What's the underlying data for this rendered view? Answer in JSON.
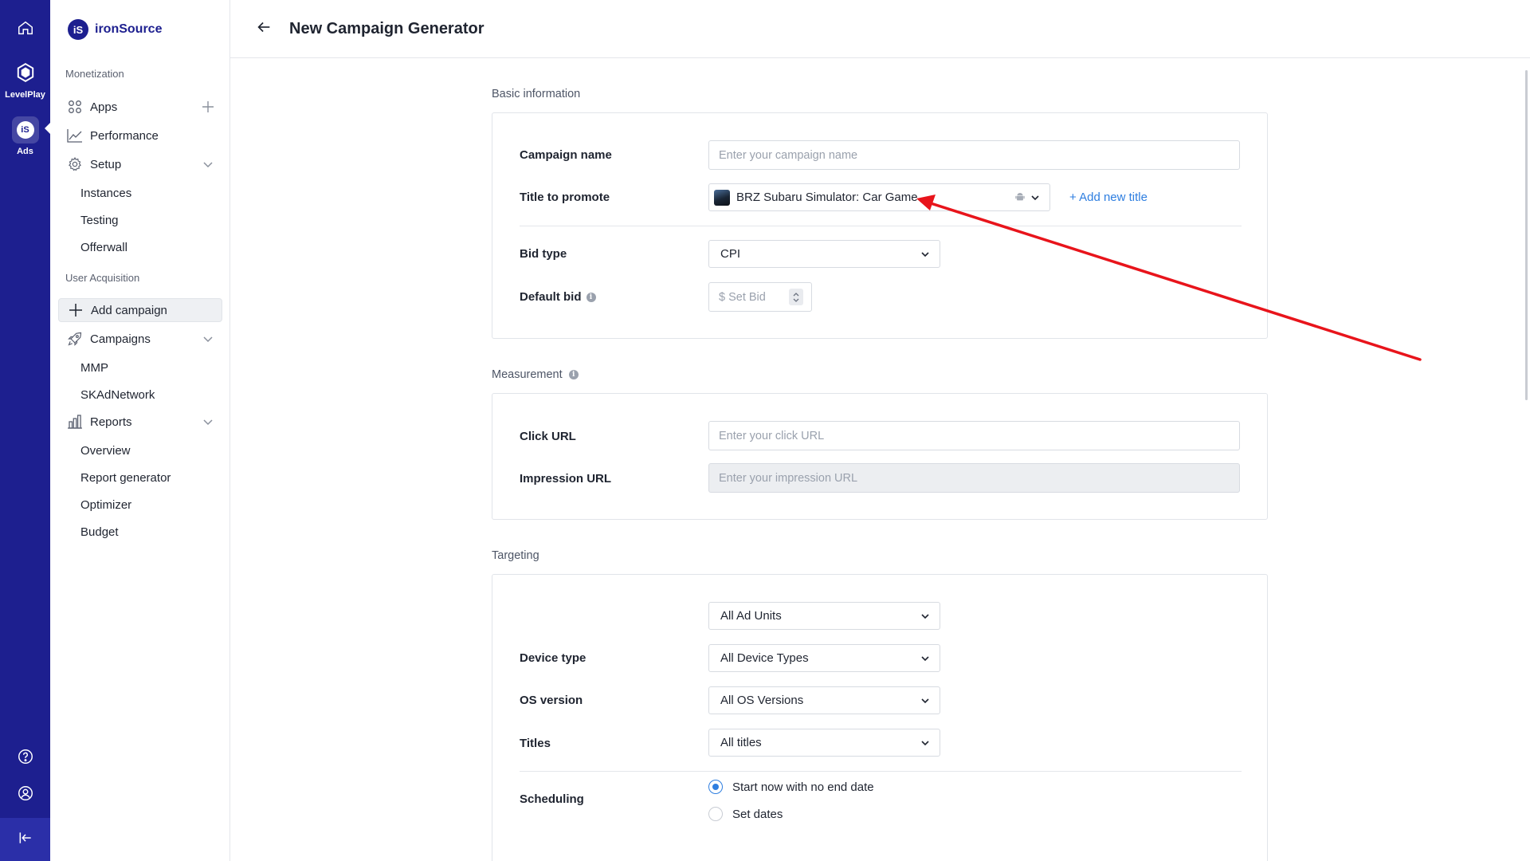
{
  "rail": {
    "levelplay_label": "LevelPlay",
    "ads_label": "Ads"
  },
  "brand": {
    "logo_text": "iS",
    "name": "ironSource"
  },
  "sidebar": {
    "monetization_title": "Monetization",
    "apps": "Apps",
    "performance": "Performance",
    "setup": "Setup",
    "instances": "Instances",
    "testing": "Testing",
    "offerwall": "Offerwall",
    "ua_title": "User Acquisition",
    "add_campaign": "Add campaign",
    "campaigns": "Campaigns",
    "mmp": "MMP",
    "skadnetwork": "SKAdNetwork",
    "reports": "Reports",
    "overview": "Overview",
    "report_generator": "Report generator",
    "optimizer": "Optimizer",
    "budget": "Budget"
  },
  "header": {
    "title": "New Campaign Generator"
  },
  "basic": {
    "section_title": "Basic information",
    "campaign_name_label": "Campaign name",
    "campaign_name_placeholder": "Enter your campaign name",
    "title_label": "Title to promote",
    "title_value": "BRZ Subaru Simulator: Car Game",
    "add_title_link": "+ Add new title",
    "bid_type_label": "Bid type",
    "bid_type_value": "CPI",
    "default_bid_label": "Default bid",
    "currency": "$",
    "bid_placeholder": "Set Bid"
  },
  "measurement": {
    "section_title": "Measurement",
    "click_url_label": "Click URL",
    "click_url_placeholder": "Enter your click URL",
    "impression_url_label": "Impression URL",
    "impression_url_placeholder": "Enter your impression URL"
  },
  "targeting": {
    "section_title": "Targeting",
    "ad_units_value": "All Ad Units",
    "device_type_label": "Device type",
    "device_type_value": "All Device Types",
    "os_version_label": "OS version",
    "os_version_value": "All OS Versions",
    "titles_label": "Titles",
    "titles_value": "All titles",
    "scheduling_label": "Scheduling",
    "schedule_option_1": "Start now with no end date",
    "schedule_option_2": "Set dates"
  },
  "colors": {
    "rail": "#1d1f8f",
    "link": "#2e7ee0",
    "annotation_arrow": "#e8141b"
  }
}
